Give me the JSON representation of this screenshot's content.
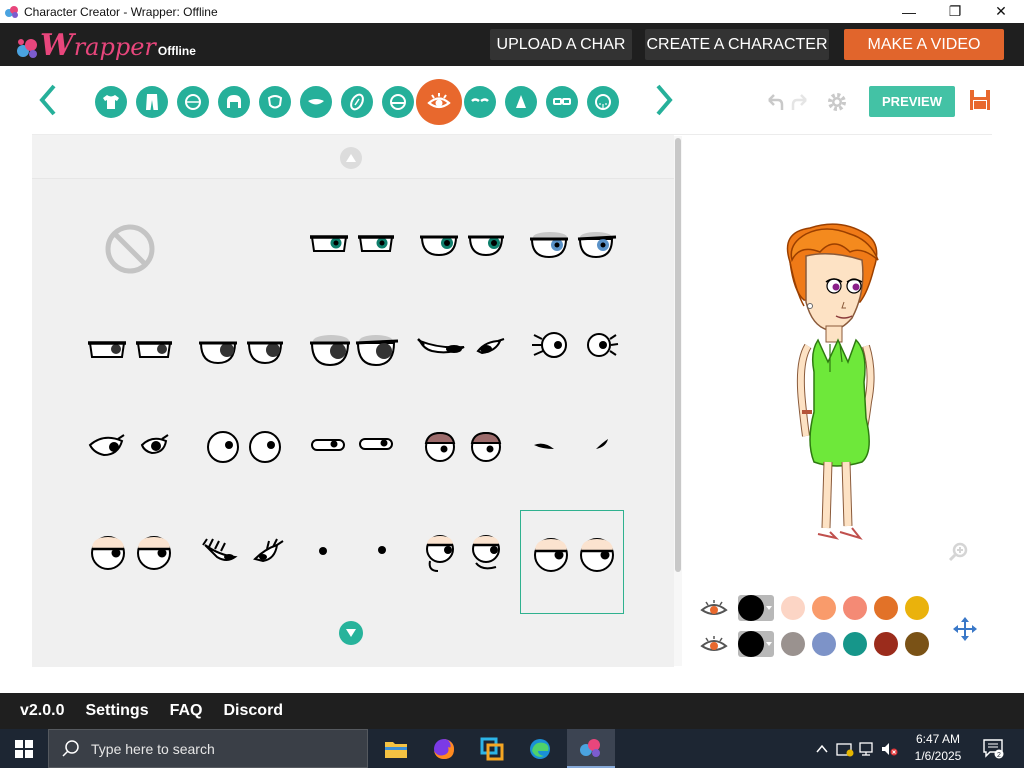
{
  "window": {
    "title": "Character Creator - Wrapper: Offline",
    "controls": [
      "—",
      "❐",
      "✕"
    ]
  },
  "appbar": {
    "logo_w": "W",
    "logo_rest": "rapper",
    "logo_offline": "Offline",
    "upload_label": "UPLOAD A CHAR",
    "create_label": "CREATE A CHARACTER",
    "make_video_label": "MAKE A VIDEO",
    "accent": "#e1652c"
  },
  "toolbar": {
    "categories": [
      {
        "icon": "shirt-icon"
      },
      {
        "icon": "pants-icon"
      },
      {
        "icon": "head-icon"
      },
      {
        "icon": "hair-icon"
      },
      {
        "icon": "face-shape-icon"
      },
      {
        "icon": "mouth-icon"
      },
      {
        "icon": "eyelash-icon"
      },
      {
        "icon": "eyebrow-shape-icon"
      },
      {
        "icon": "eye-icon",
        "selected": true
      },
      {
        "icon": "eyebrows-icon"
      },
      {
        "icon": "nose-icon"
      },
      {
        "icon": "glasses-icon"
      },
      {
        "icon": "beard-icon"
      }
    ],
    "preview_label": "PREVIEW",
    "teal": "#26b09a",
    "selected_color": "#e8682d"
  },
  "panel": {
    "items": [
      {
        "kind": "none"
      },
      {
        "kind": "flat-rect-green"
      },
      {
        "kind": "round-green"
      },
      {
        "kind": "lidded-blue"
      },
      {
        "kind": "flat-rect-black"
      },
      {
        "kind": "half-black"
      },
      {
        "kind": "lidded-black"
      },
      {
        "kind": "sly-lashes"
      },
      {
        "kind": "wide-lashes"
      },
      {
        "kind": "almond-lashes"
      },
      {
        "kind": "round-open"
      },
      {
        "kind": "narrow-flat"
      },
      {
        "kind": "lidded-brown"
      },
      {
        "kind": "slash"
      },
      {
        "kind": "lidded-peach"
      },
      {
        "kind": "closed-lashes"
      },
      {
        "kind": "dots"
      },
      {
        "kind": "wrinkled"
      },
      {
        "kind": "lidded-peach-selected",
        "selected": true
      },
      {
        "kind": "button-eyes"
      },
      {
        "kind": "lidded-white"
      }
    ]
  },
  "colors": {
    "row1": [
      "#000000",
      "#fcd5c5",
      "#f99b6b",
      "#f48a75",
      "#e27228",
      "#eab20c"
    ],
    "row2": [
      "#000000",
      "#9a928f",
      "#7d93c8",
      "#16968a",
      "#9b2c1c",
      "#7a5216"
    ]
  },
  "footer": {
    "version": "v2.0.0",
    "settings": "Settings",
    "faq": "FAQ",
    "discord": "Discord"
  },
  "taskbar": {
    "search_placeholder": "Type here to search",
    "time": "6:47 AM",
    "date": "1/6/2025",
    "notifications": "2"
  }
}
